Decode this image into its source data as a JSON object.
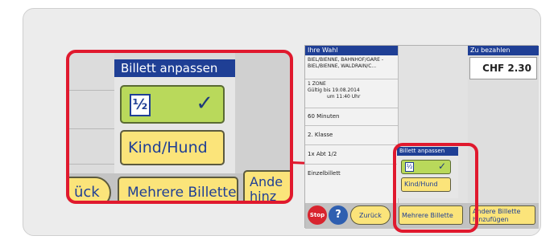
{
  "zoom": {
    "header": "Billett anpassen",
    "half_glyph": "½",
    "check": "✓",
    "kind_label": "Kind/Hund",
    "zurueck_label": "ück",
    "mehrere_label": "Mehrere Billette",
    "andere_label": "Ande\nhinz"
  },
  "mini": {
    "selection_header": "Ihre Wahl",
    "route": "BIEL/BIENNE, BAHNHOF/GARE - BIEL/BIENNE, WALDRAIN/C...",
    "zone": "1 ZONE",
    "valid_label": "Gültig bis",
    "valid_date": "19.08.2014",
    "valid_time": "um 11:40 Uhr",
    "duration": "60 Minuten",
    "class": "2. Klasse",
    "fare": "1x Abt 1/2",
    "ticket_type": "Einzelbillett",
    "pay_header": "Zu bezahlen",
    "pay_amount": "CHF  2.30",
    "popup_header": "Billett anpassen",
    "half_glyph": "½",
    "check": "✓",
    "kind_label": "Kind/Hund",
    "stop_label": "Stop",
    "help_label": "?",
    "zurueck_label": "Zurück",
    "mehrere_label": "Mehrere Billette",
    "andere_label": "Andere Billette hinzufügen"
  },
  "colors": {
    "header_blue": "#1f3f95",
    "button_yellow": "#fbe47a",
    "selected_green": "#b9d95b",
    "highlight_red": "#e0192e",
    "stop_red": "#d8242e",
    "help_blue": "#2f5fb0"
  }
}
